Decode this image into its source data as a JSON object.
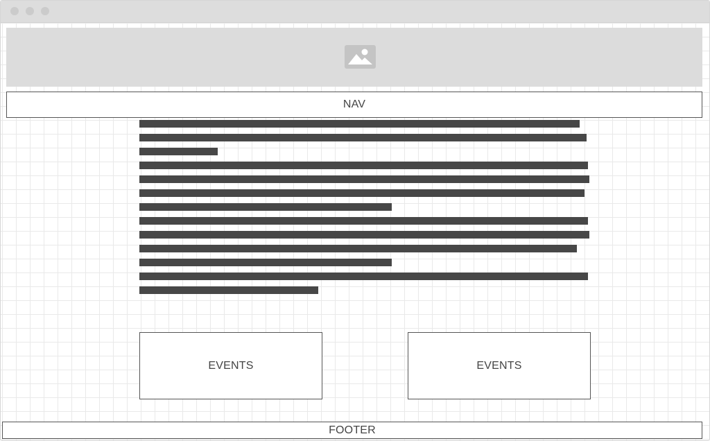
{
  "window": {
    "controls": [
      "close-dot",
      "minimize-dot",
      "maximize-dot"
    ]
  },
  "hero": {
    "icon": "image-placeholder-icon"
  },
  "nav": {
    "label": "NAV"
  },
  "events": [
    {
      "label": "EVENTS"
    },
    {
      "label": "EVENTS"
    }
  ],
  "footer": {
    "label": "FOOTER"
  },
  "colors": {
    "titlebar": "#dddddd",
    "placeholder_fill": "#dcdcdc",
    "text_placeholder": "#474747",
    "border": "#555555"
  }
}
